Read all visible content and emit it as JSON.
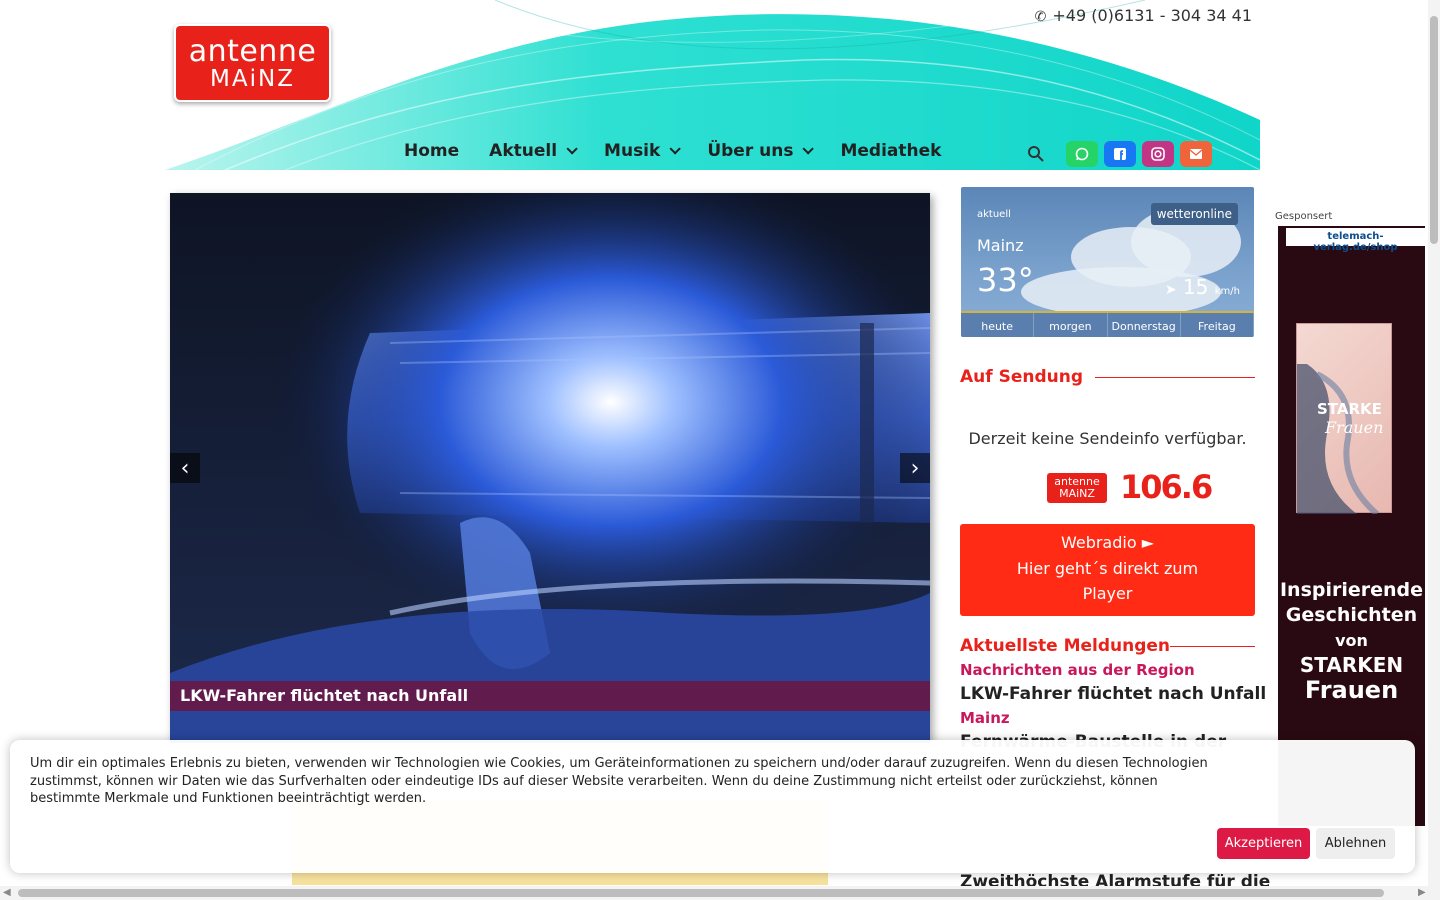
{
  "header": {
    "logo_line1": "antenne",
    "logo_line2": "MAiNZ",
    "phone": "+49 (0)6131 - 304 34 41"
  },
  "nav": {
    "home": "Home",
    "aktuell": "Aktuell",
    "musik": "Musik",
    "ueber_uns": "Über uns",
    "mediathek": "Mediathek"
  },
  "social": {
    "colors": {
      "whatsapp": "#25d366",
      "facebook": "#1877f2",
      "instagram": "#c13584",
      "email": "#f0643c"
    }
  },
  "slider": {
    "caption": "LKW-Fahrer flüchtet nach Unfall",
    "prev": "‹",
    "next": "›"
  },
  "weather": {
    "label": "aktuell",
    "brand": "wetteronline",
    "city": "Mainz",
    "temperature": "33°",
    "wind_speed": "15",
    "wind_unit": "km/h",
    "days": [
      "heute",
      "morgen",
      "Donnerstag",
      "Freitag"
    ]
  },
  "on_air": {
    "title": "Auf Sendung",
    "no_info": "Derzeit keine Sendeinfo verfügbar.",
    "mini_logo_line1": "antenne",
    "mini_logo_line2": "MAiNZ",
    "frequency": "106.6"
  },
  "webradio": {
    "line1": "Webradio ►",
    "line2": "Hier geht´s direkt zum",
    "line3": "Player"
  },
  "latest": {
    "title": "Aktuellste Meldungen",
    "items": [
      {
        "category": "Nachrichten aus der Region",
        "headline": "LKW-Fahrer flüchtet nach Unfall"
      },
      {
        "category": "Mainz",
        "headline": "Fernwärme-Baustelle in der"
      },
      {
        "category": "",
        "headline": "Zweithöchste Alarmstufe für die"
      }
    ]
  },
  "ad": {
    "label": "Gesponsert",
    "url": "telemach-verlag.de/shop",
    "book_title_1": "STARKE",
    "book_title_2": "Frauen",
    "text_1": "Inspirierende",
    "text_2": "Geschichten",
    "text_3": "von",
    "text_4": "STARKEN",
    "text_5": "Frauen"
  },
  "cookie": {
    "text": "Um dir ein optimales Erlebnis zu bieten, verwenden wir Technologien wie Cookies, um Geräteinformationen zu speichern und/oder darauf zuzugreifen. Wenn du diesen Technologien zustimmst, können wir Daten wie das Surfverhalten oder eindeutige IDs auf dieser Website verarbeiten. Wenn du deine Zustimmung nicht erteilst oder zurückziehst, können bestimmte Merkmale und Funktionen beeinträchtigt werden.",
    "accept": "Akzeptieren",
    "decline": "Ablehnen"
  }
}
